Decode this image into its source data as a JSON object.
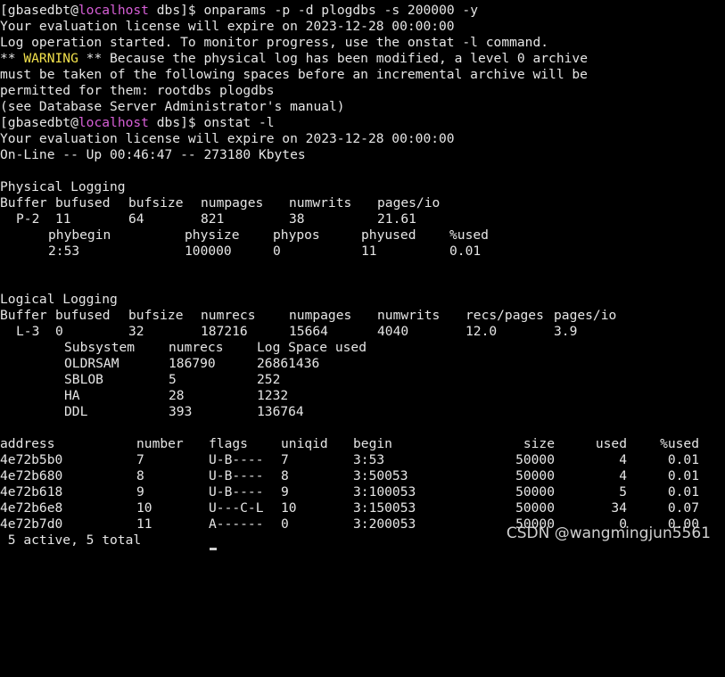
{
  "prompt1": {
    "open": "[",
    "user": "gbasedbt",
    "at": "@",
    "host": "localhost",
    "path": " dbs]$ ",
    "command": "onparams -p -d plogdbs -s 200000 -y"
  },
  "out1": [
    "Your evaluation license will expire on 2023-12-28 00:00:00",
    "Log operation started. To monitor progress, use the onstat -l command."
  ],
  "warning": {
    "prefix": "** ",
    "word": "WARNING",
    "rest": " ** Because the physical log has been modified, a level 0 archive"
  },
  "out2": [
    "must be taken of the following spaces before an incremental archive will be",
    "permitted for them: rootdbs plogdbs",
    "(see Database Server Administrator's manual)"
  ],
  "prompt2": {
    "open": "[",
    "user": "gbasedbt",
    "at": "@",
    "host": "localhost",
    "path": " dbs]$ ",
    "command": "onstat -l"
  },
  "out3": [
    "Your evaluation license will expire on 2023-12-28 00:00:00",
    "On-Line -- Up 00:46:47 -- 273180 Kbytes"
  ],
  "physical": {
    "heading": "Physical Logging",
    "hdr1": [
      "Buffer",
      "bufused",
      "bufsize",
      "numpages",
      "numwrits",
      "pages/io"
    ],
    "val1": [
      "P-2",
      "11",
      "64",
      "821",
      "38",
      "21.61"
    ],
    "hdr2": [
      "phybegin",
      "physize",
      "phypos",
      "phyused",
      "%used"
    ],
    "val2": [
      "2:53",
      "100000",
      "0",
      "11",
      "0.01"
    ]
  },
  "logical": {
    "heading": "Logical Logging",
    "hdr1": [
      "Buffer",
      "bufused",
      "bufsize",
      "numrecs",
      "numpages",
      "numwrits",
      "recs/pages",
      "pages/io"
    ],
    "val1": [
      "L-3",
      "0",
      "32",
      "187216",
      "15664",
      "4040",
      "12.0",
      "3.9"
    ],
    "sub_hdr": [
      "Subsystem",
      "numrecs",
      "Log Space used"
    ],
    "subsystems": [
      [
        "OLDRSAM",
        "186790",
        "26861436"
      ],
      [
        "SBLOB",
        "5",
        "252"
      ],
      [
        "HA",
        "28",
        "1232"
      ],
      [
        "DDL",
        "393",
        "136764"
      ]
    ]
  },
  "logfiles": {
    "headers": [
      "address",
      "number",
      "flags",
      "uniqid",
      "begin",
      "size",
      "used",
      "%used"
    ],
    "rows": [
      [
        "4e72b5b0",
        "7",
        "U-B----",
        "7",
        "3:53",
        "50000",
        "4",
        "0.01"
      ],
      [
        "4e72b680",
        "8",
        "U-B----",
        "8",
        "3:50053",
        "50000",
        "4",
        "0.01"
      ],
      [
        "4e72b618",
        "9",
        "U-B----",
        "9",
        "3:100053",
        "50000",
        "5",
        "0.01"
      ],
      [
        "4e72b6e8",
        "10",
        "U---C-L",
        "10",
        "3:150053",
        "50000",
        "34",
        "0.07"
      ],
      [
        "4e72b7d0",
        "11",
        "A------",
        "0",
        "3:200053",
        "50000",
        "0",
        "0.00"
      ]
    ],
    "summary": " 5 active, 5 total"
  },
  "watermark": "CSDN @wangmingjun5561",
  "colors": {
    "background": "#000000",
    "text": "#e6e6e6",
    "host": "#d75fd7",
    "warning": "#f2e14c"
  }
}
